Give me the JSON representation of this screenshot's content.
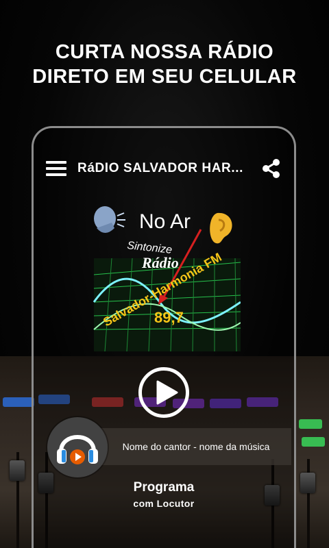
{
  "headline": {
    "line1": "CURTA NOSSA RÁDIO",
    "line2": "DIRETO EM SEU CELULAR"
  },
  "appbar": {
    "title": "RáDIO SALVADOR HAR...",
    "menu_icon": "hamburger-menu-icon",
    "share_icon": "share-icon"
  },
  "logo": {
    "on_air": "No Ar",
    "tune_in": "Sintonize",
    "radio": "Rádio",
    "station": "Salvador-Harmonia FM",
    "frequency": "89,7"
  },
  "player": {
    "play_icon": "play-icon",
    "now_playing": "Nome do cantor - nome da música",
    "avatar_icon": "headphones-icon",
    "program": "Programa",
    "host": "com Locutor"
  },
  "colors": {
    "background": "#000000",
    "frame": "#8c8c8c",
    "logo_text_yellow": "#f5c518",
    "logo_grid_green": "#27c24c",
    "avatar_accent": "#e65c00",
    "avatar_bg": "#424242"
  }
}
